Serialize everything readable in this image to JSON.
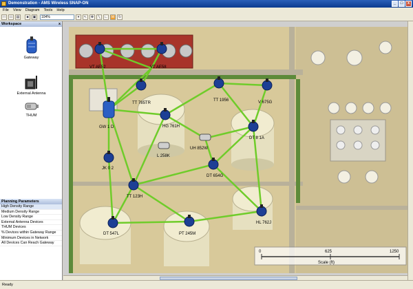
{
  "window": {
    "title": "Demonstration - AMS Wireless SNAP-ON",
    "btn_min": "_",
    "btn_max": "□",
    "btn_close": "x"
  },
  "menu": [
    "File",
    "View",
    "Diagram",
    "Tools",
    "Help"
  ],
  "toolbar": {
    "zoom": "104%",
    "m_label": "M"
  },
  "workspace": {
    "title": "Workspace",
    "close_glyph": "x",
    "palette": [
      {
        "label": "Gateway",
        "icon": "gateway-icon"
      },
      {
        "label": "External Antenna",
        "icon": "antenna-icon"
      },
      {
        "label": "THUM",
        "icon": "thum-icon"
      }
    ]
  },
  "planning": {
    "title": "Planning Parameters",
    "items": [
      "High Density Range",
      "Medium Density Range",
      "Low Density Range",
      "External Antenna Devices",
      "THUM Devices",
      "% Devices within Gateway Range",
      "Minimum Devices in Network",
      "All Devices Can Reach Gateway"
    ]
  },
  "map": {
    "labels": {
      "vt_a": "VT AE52",
      "vt_b": "VT AE58",
      "tt_785": "TT 785TR",
      "tt_195": "TT 1956",
      "v675": "V 675G",
      "gw": "GW 1 D",
      "hg761": "HG 761H",
      "dt": "DT 8 1A",
      "uh852": "UH 852W",
      "l258": "L 258K",
      "jk": "JK 0 2",
      "dt654": "DT 654G",
      "tt123": "TT 123H",
      "dt547": "DT 547L",
      "pt245": "PT 245M",
      "hl762": "HL 762J"
    },
    "scale": {
      "start": "0",
      "mid": "625",
      "end": "1250",
      "label": "Scale (ft)"
    }
  },
  "status": "Ready"
}
